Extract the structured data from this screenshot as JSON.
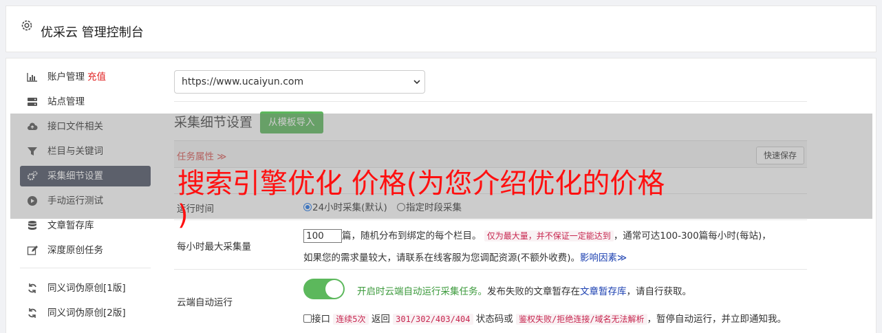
{
  "header": {
    "title": "优采云 管理控制台",
    "icon": "gear-icon"
  },
  "sidebar": {
    "items": [
      {
        "label": "账户管理",
        "badge": "充值",
        "icon": "bar-chart-icon"
      },
      {
        "label": "站点管理",
        "icon": "server-icon"
      },
      {
        "label": "接口文件相关",
        "icon": "cloud-upload-icon"
      },
      {
        "label": "栏目与关键词",
        "icon": "filter-icon"
      },
      {
        "label": "采集细节设置",
        "icon": "cogs-icon",
        "active": true
      },
      {
        "label": "手动运行测试",
        "icon": "play-circle-icon"
      },
      {
        "label": "文章暂存库",
        "icon": "database-icon"
      },
      {
        "label": "深度原创任务",
        "icon": "edit-icon"
      }
    ],
    "items2": [
      {
        "label": "同义词伪原创[1版]",
        "icon": "refresh-icon"
      },
      {
        "label": "同义词伪原创[2版]",
        "icon": "refresh-icon"
      }
    ]
  },
  "site_select": {
    "value": "https://www.ucaiyun.com"
  },
  "section": {
    "title": "采集细节设置",
    "import_button": "从模板导入"
  },
  "task_bar": {
    "label": "任务属性 ≫",
    "quick_save": "快速保存"
  },
  "rows": {
    "run_time": {
      "label": "运行时间",
      "option1": "24小时采集(默认)",
      "option2": "指定时段采集"
    },
    "max_per_hour": {
      "label": "每小时最大采集量",
      "value": "100",
      "text1": "篇，随机分布到绑定的每个栏目。",
      "note": "仅为最大量，并不保证一定能达到",
      "text2": "，通常可达100-300篇每小时(每站)，",
      "text3": "如果您的需求量较大，请联系在线客服为您调配资源(不额外收费)。",
      "link": "影响因素≫"
    },
    "cloud_auto": {
      "label": "云端自动运行",
      "desc_green": "开启时云端自动运行采集任务。",
      "desc1": "发布失败的文章暂存在",
      "desc_link": "文章暂存库",
      "desc2": "，请自行获取。",
      "check_label": "接口",
      "code1": "连续5次",
      "t1": "返回",
      "code2": "301/302/403/404",
      "t2": "状态码或",
      "code3": "鉴权失败/拒绝连接/域名无法解析",
      "t3": "，暂停自动运行，并立即通知我。"
    }
  },
  "overlay": {
    "line1": "搜索引擎优化 价格(为您介绍优化的价格",
    "line2": ")"
  },
  "colors": {
    "active_bg": "#4b5263",
    "green": "#5cb85c",
    "red": "#e02020",
    "overlay_text": "#ff1010"
  }
}
